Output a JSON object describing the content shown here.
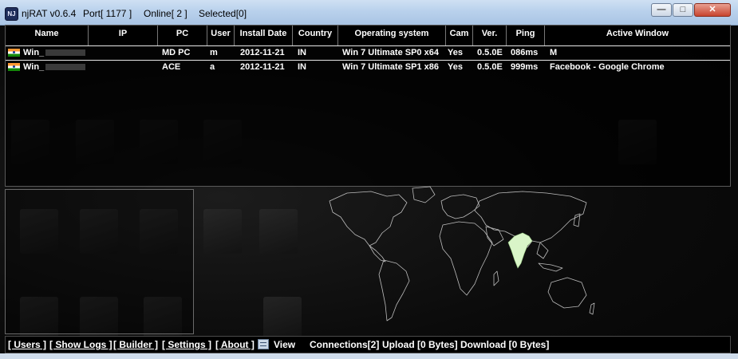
{
  "window": {
    "app_name": "njRAT v0.6.4",
    "port": "Port[ 1177 ]",
    "online": "Online[ 2 ]",
    "selected": "Selected[0]",
    "icon_text": "NJ",
    "controls": [
      "minimize",
      "maximize",
      "close"
    ]
  },
  "columns": [
    "Name",
    "IP",
    "PC",
    "User",
    "Install Date",
    "Country",
    "Operating system",
    "Cam",
    "Ver.",
    "Ping",
    "Active Window"
  ],
  "rows": [
    {
      "flag": "india-flag",
      "name": "Win_",
      "ip": "",
      "pc": "MD PC",
      "user": "m",
      "install_date": "2012-11-21",
      "country": "IN",
      "os": "Win 7 Ultimate SP0 x64",
      "cam": "Yes",
      "ver": "0.5.0E",
      "ping": "086ms",
      "active_window": "M"
    },
    {
      "flag": "india-flag",
      "name": "Win_",
      "ip": "",
      "pc": "ACE",
      "user": "a",
      "install_date": "2012-11-21",
      "country": "IN",
      "os": "Win 7 Ultimate SP1 x86",
      "cam": "Yes",
      "ver": "0.5.0E",
      "ping": "999ms",
      "active_window": "Facebook - Google Chrome"
    }
  ],
  "status": {
    "users": "[ Users ]",
    "show_logs": "[ Show Logs ]",
    "builder": "[ Builder ]",
    "settings": "[ Settings ]",
    "about": "[ About ]",
    "view": "View",
    "connections": "Connections[2]",
    "upload": "Upload [0 Bytes]",
    "download": "Download [0 Bytes]"
  },
  "map": {
    "highlight_country": "India",
    "highlight_color": "#d9f5c8",
    "outline_color": "#bdbdbd"
  }
}
